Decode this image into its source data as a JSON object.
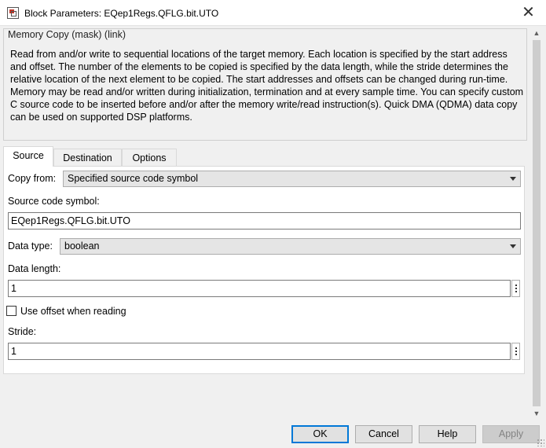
{
  "window": {
    "title": "Block Parameters: EQep1Regs.QFLG.bit.UTO",
    "close_glyph": "✕"
  },
  "mask": {
    "title": "Memory Copy (mask) (link)",
    "description_1": "Read from and/or write to sequential locations of the target memory. Each location is specified by the start address and offset. The number of the elements to be copied is specified by the data length, while the stride determines the relative location of the next element to be copied. The start addresses and offsets can be changed during run-time.",
    "description_2": "Memory may be read and/or written during initialization, termination and at every sample time. You can specify custom C source code to be inserted before and/or after the memory write/read instruction(s). Quick DMA (QDMA) data copy can be used on supported DSP platforms."
  },
  "tabs": [
    {
      "label": "Source",
      "active": true
    },
    {
      "label": "Destination",
      "active": false
    },
    {
      "label": "Options",
      "active": false
    }
  ],
  "source": {
    "copy_from_label": "Copy from:",
    "copy_from_value": "Specified source code symbol",
    "symbol_label": "Source code symbol:",
    "symbol_value": "EQep1Regs.QFLG.bit.UTO",
    "data_type_label": "Data type:",
    "data_type_value": "boolean",
    "data_length_label": "Data length:",
    "data_length_value": "1",
    "use_offset_label": "Use offset when reading",
    "use_offset_checked": false,
    "stride_label": "Stride:",
    "stride_value": "1"
  },
  "buttons": {
    "ok": "OK",
    "cancel": "Cancel",
    "help": "Help",
    "apply": "Apply"
  },
  "colors": {
    "accent": "#0078d7"
  }
}
